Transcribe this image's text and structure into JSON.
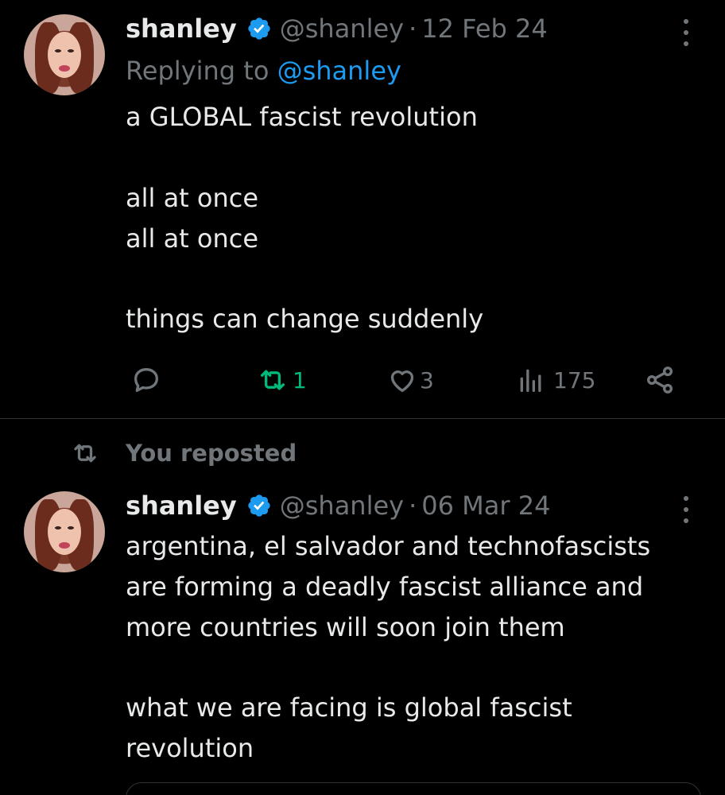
{
  "colors": {
    "background": "#000000",
    "text": "#e7e9ea",
    "muted": "#71767b",
    "link": "#1d9bf0",
    "repost_green": "#00ba7c",
    "verified_blue": "#1d9bf0",
    "divider": "#2f3336"
  },
  "tweet1": {
    "name": "shanley",
    "handle": "@shanley",
    "separator": "·",
    "date": "12 Feb 24",
    "replying_prefix": "Replying to ",
    "replying_to": "@shanley",
    "body_lines": [
      "a GLOBAL fascist revolution",
      "all at once",
      "all at once",
      "things can change suddenly"
    ],
    "actions": {
      "reply_icon": "reply-icon",
      "repost_icon": "repost-icon",
      "repost_count": "1",
      "like_icon": "heart-icon",
      "like_count": "3",
      "views_icon": "views-icon",
      "views_count": "175",
      "share_icon": "share-icon"
    }
  },
  "repost_notice": {
    "icon": "repost-icon",
    "text": "You reposted"
  },
  "tweet2": {
    "name": "shanley",
    "handle": "@shanley",
    "separator": "·",
    "date": "06 Mar 24",
    "body_lines": [
      "argentina, el salvador and technofascists",
      "are forming a deadly fascist alliance and",
      "more countries will soon join them",
      "what we are facing is global fascist",
      "revolution"
    ]
  }
}
